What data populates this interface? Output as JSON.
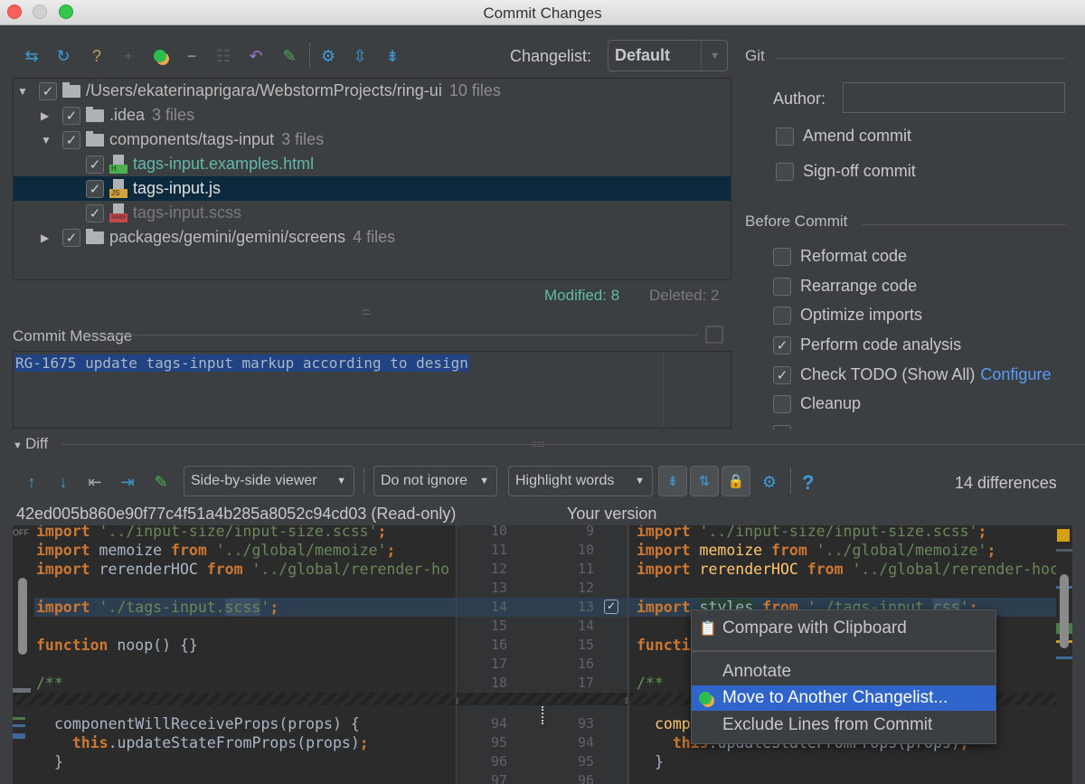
{
  "window": {
    "title": "Commit Changes"
  },
  "toolbar": {
    "icons": [
      "show-diff-icon",
      "refresh-icon",
      "unversioned-files-icon",
      "add-icon",
      "move-to-changelist-icon",
      "remove-icon",
      "group-by-icon",
      "rollback-icon",
      "edit-source-icon",
      "settings-icon",
      "expand-all-icon",
      "collapse-all-icon"
    ]
  },
  "changelist": {
    "label": "Changelist:",
    "value": "Default"
  },
  "tree": {
    "rows": [
      {
        "name": "/Users/ekaterinaprigara/WebstormProjects/ring-ui",
        "count": "10 files",
        "level": 0,
        "expanded": true,
        "type": "folder"
      },
      {
        "name": ".idea",
        "count": "3 files",
        "level": 1,
        "expanded": false,
        "type": "folder"
      },
      {
        "name": "components/tags-input",
        "count": "3 files",
        "level": 1,
        "expanded": true,
        "type": "folder"
      },
      {
        "name": "tags-input.examples.html",
        "level": 2,
        "type": "html",
        "tag": "H",
        "color": "#62b8a8"
      },
      {
        "name": "tags-input.js",
        "level": 2,
        "type": "js",
        "tag": "JS",
        "color": "#e0e0e0",
        "selected": true
      },
      {
        "name": "tags-input.scss",
        "level": 2,
        "type": "sass",
        "tag": "SASS",
        "color": "#7a7a7a"
      },
      {
        "name": "packages/gemini/gemini/screens",
        "count": "4 files",
        "level": 1,
        "expanded": false,
        "type": "folder"
      }
    ],
    "modified": "Modified: 8",
    "deleted": "Deleted: 2"
  },
  "commit_message": {
    "label": "Commit Message",
    "value": "RG-1675 update tags-input markup according to design"
  },
  "git": {
    "label": "Git",
    "author_label": "Author:",
    "author_value": "",
    "amend": "Amend commit",
    "signoff": "Sign-off commit"
  },
  "before_commit": {
    "label": "Before Commit",
    "options": [
      {
        "label": "Reformat code",
        "checked": false
      },
      {
        "label": "Rearrange code",
        "checked": false
      },
      {
        "label": "Optimize imports",
        "checked": false
      },
      {
        "label": "Perform code analysis",
        "checked": true
      },
      {
        "label": "Check TODO (Show All)",
        "checked": true,
        "link": "Configure"
      },
      {
        "label": "Cleanup",
        "checked": false
      }
    ]
  },
  "diff": {
    "label": "Diff",
    "viewer": "Side-by-side viewer",
    "ignore": "Do not ignore",
    "highlight": "Highlight words",
    "help": "?",
    "differences": "14 differences",
    "left_title": "42ed005b860e90f77c4f51a4b285a8052c94cd03 (Read-only)",
    "right_title": "Your version",
    "off_label": "OFF",
    "left_lines": [
      "10",
      "11",
      "12",
      "13",
      "14",
      "15",
      "16",
      "17",
      "18"
    ],
    "right_lines": [
      "9",
      "10",
      "11",
      "12",
      "13",
      "14",
      "15",
      "16",
      "17"
    ],
    "left_lines2": [
      "94",
      "95",
      "96",
      "97"
    ],
    "right_lines2": [
      "93",
      "94",
      "95",
      "96"
    ]
  },
  "context_menu": {
    "items": [
      "Compare with Clipboard",
      "Annotate",
      "Move to Another Changelist...",
      "Exclude Lines from Commit"
    ],
    "active": 2
  }
}
